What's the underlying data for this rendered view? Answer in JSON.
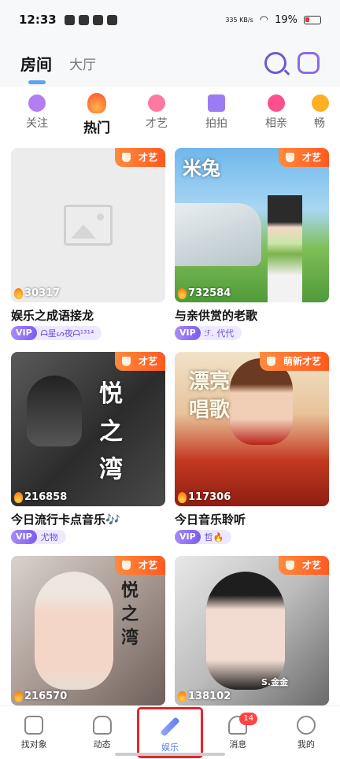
{
  "status": {
    "time": "12:33",
    "net": "335\nKB/s",
    "battery": "19%"
  },
  "header": {
    "tab_active": "房间",
    "tab_other": "大厅"
  },
  "categories": [
    {
      "label": "关注",
      "color": "#b57df4"
    },
    {
      "label": "热门",
      "color": "#ff5a1f"
    },
    {
      "label": "才艺",
      "color": "#ff7aa0"
    },
    {
      "label": "拍拍",
      "color": "#9c7cf2"
    },
    {
      "label": "相亲",
      "color": "#ff4f8c"
    },
    {
      "label": "畅",
      "color": "#ffb020"
    }
  ],
  "cards": [
    {
      "badge": "才艺",
      "heat": "30317",
      "title": "娱乐之成语接龙",
      "vip": "VIP",
      "owner": "ᗩ星ᔕ夜ᗩ¹³¹⁴"
    },
    {
      "badge": "才艺",
      "heat": "732584",
      "title": "与亲供赏的老歌",
      "vip": "VIP",
      "owner": "ℱ. 代代",
      "overlay": "米兔"
    },
    {
      "badge": "才艺",
      "heat": "216858",
      "title": "今日流行卡点音乐🎶",
      "vip": "VIP",
      "owner": "尤物",
      "overlay": "悦之湾"
    },
    {
      "badge": "萌新才艺",
      "heat": "117306",
      "title": "今日音乐聆听",
      "vip": "VIP",
      "owner": "哲🔥",
      "overlay": "漂亮唱歌"
    },
    {
      "badge": "才艺",
      "heat": "216570",
      "title": "",
      "vip": "",
      "owner": "",
      "overlay": "悦之湾"
    },
    {
      "badge": "才艺",
      "heat": "138102",
      "title": "",
      "vip": "",
      "owner": "",
      "overlay": "S.金金"
    }
  ],
  "nav": [
    {
      "label": "找对象"
    },
    {
      "label": "动态"
    },
    {
      "label": "娱乐"
    },
    {
      "label": "消息",
      "badge": "14"
    },
    {
      "label": "我的"
    }
  ]
}
